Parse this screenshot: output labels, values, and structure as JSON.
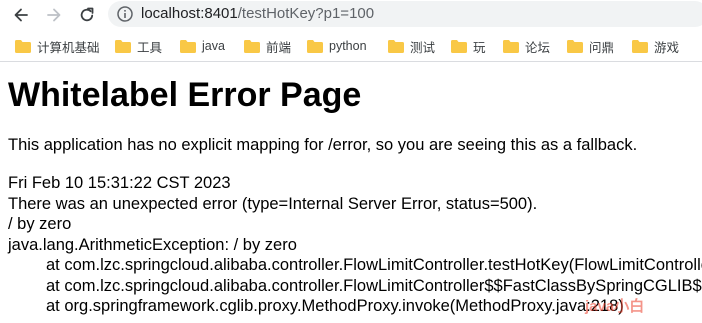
{
  "browser": {
    "url_host": "localhost:8401",
    "url_path": "/testHotKey?p1=100",
    "bookmarks": [
      {
        "label": "计算机基础"
      },
      {
        "label": "工具"
      },
      {
        "label": "java"
      },
      {
        "label": "前端"
      },
      {
        "label": "python"
      },
      {
        "label": "测试"
      },
      {
        "label": "玩"
      },
      {
        "label": "论坛"
      },
      {
        "label": "问鼎"
      },
      {
        "label": "游戏"
      }
    ],
    "folder_color": "#f9c846"
  },
  "page": {
    "title": "Whitelabel Error Page",
    "description": "This application has no explicit mapping for /error, so you are seeing this as a fallback.",
    "timestamp": "Fri Feb 10 15:31:22 CST 2023",
    "error_line": "There was an unexpected error (type=Internal Server Error, status=500).",
    "message": "/ by zero",
    "exception": "java.lang.ArithmeticException: / by zero",
    "stack": [
      "at com.lzc.springcloud.alibaba.controller.FlowLimitController.testHotKey(FlowLimitController.java",
      "at com.lzc.springcloud.alibaba.controller.FlowLimitController$$FastClassBySpringCGLIB$$",
      "at org.springframework.cglib.proxy.MethodProxy.invoke(MethodProxy.java:218)"
    ]
  },
  "watermark": "java小白"
}
